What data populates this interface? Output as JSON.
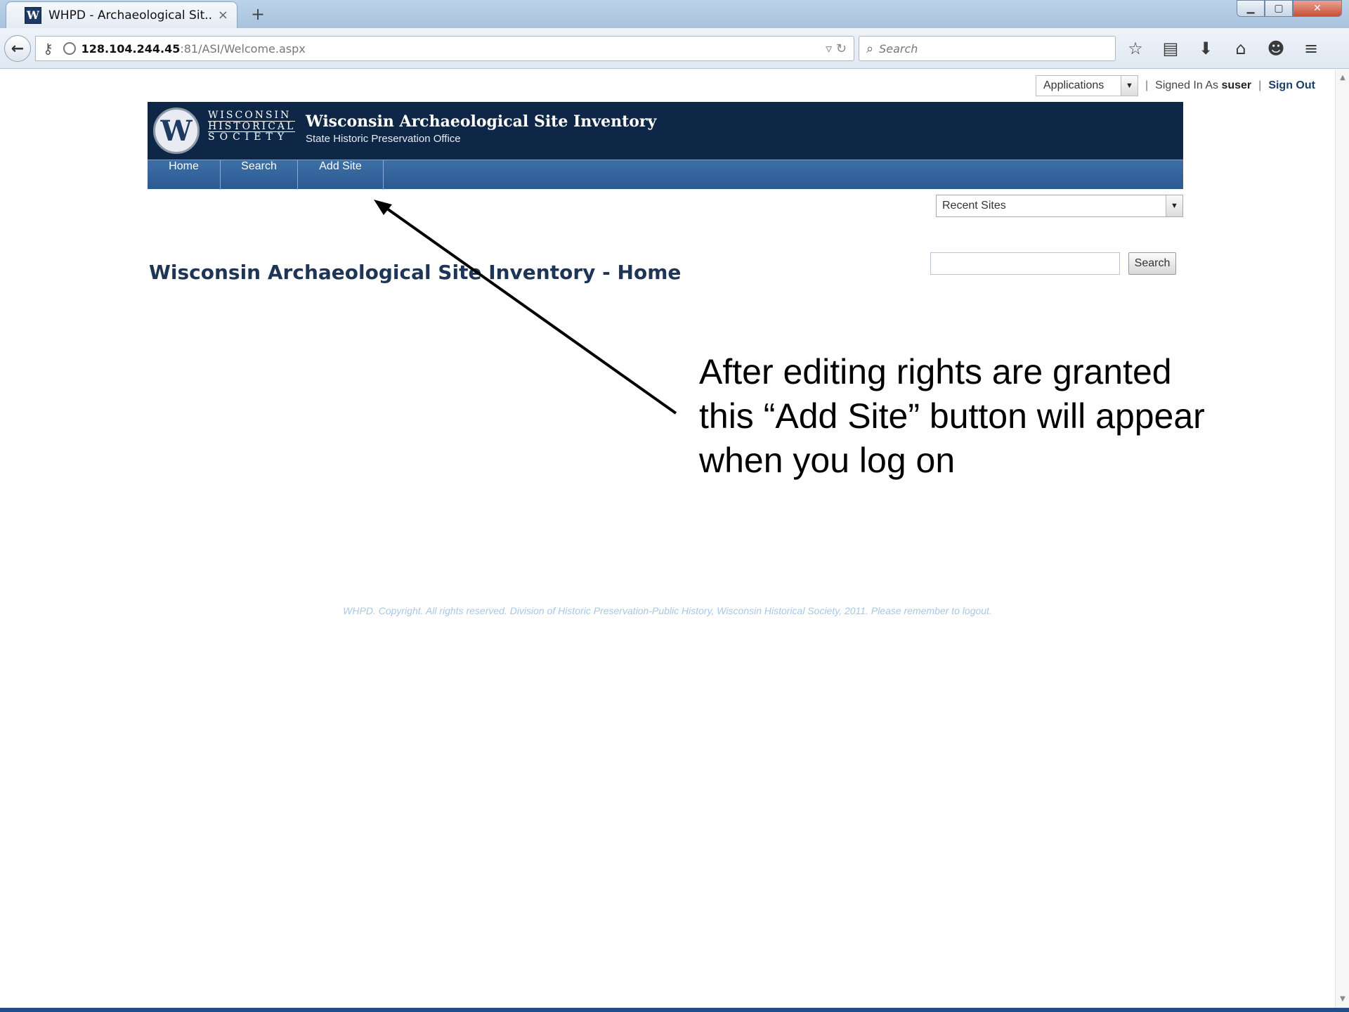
{
  "browser": {
    "tab_title": "WHPD - Archaeological Sit...",
    "tab_close": "×",
    "new_tab": "+",
    "favicon_letter": "W",
    "url_host": "128.104.244.45",
    "url_rest": ":81/ASI/Welcome.aspx",
    "search_placeholder": "Search",
    "icons": [
      "star-icon",
      "clipboard-icon",
      "download-icon",
      "home-icon",
      "chat-icon",
      "menu-icon"
    ]
  },
  "topbar": {
    "applications_label": "Applications",
    "sep": "|",
    "signed_in_prefix": "Signed In As",
    "username": "suser",
    "sign_out": "Sign Out"
  },
  "header": {
    "logo_letter": "W",
    "logo_line1": "WISCONSIN",
    "logo_line2": "HISTORICAL",
    "logo_line3": "SOCIETY",
    "title": "Wisconsin Archaeological Site Inventory",
    "subtitle": "State Historic Preservation Office"
  },
  "menu": {
    "home": "Home",
    "search": "Search",
    "add_site": "Add Site",
    "search_button": "Search"
  },
  "recent_sites": "Recent Sites",
  "page_heading": "Wisconsin Archaeological Site Inventory - Home",
  "footer": "WHPD. Copyright. All rights reserved. Division of Historic Preservation-Public History, Wisconsin Historical Society, 2011. Please remember to logout.",
  "annotation": {
    "line1": "After editing rights are granted",
    "line2": "this “Add Site” button will appear",
    "line3": "when you log on"
  },
  "colors": {
    "header_bg": "#0f2747",
    "menu_bg": "#2b5a91",
    "heading": "#1e3556"
  }
}
